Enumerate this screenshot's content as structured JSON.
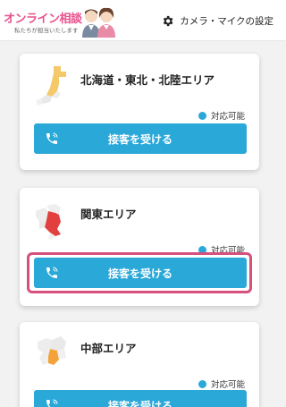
{
  "header": {
    "logo_title": "オンライン相談",
    "logo_subtitle": "私たちが担当いたします",
    "settings_label": "カメラ・マイクの設定"
  },
  "colors": {
    "brand_pink": "#e8508c",
    "accent_blue": "#2aa8d8",
    "highlight": "#d6507e",
    "map_yellow": "#f5c96a",
    "map_red": "#e2403e",
    "map_orange": "#f4a23a"
  },
  "icons": {
    "settings": "gear-icon",
    "call": "phone-icon",
    "status": "status-dot-icon"
  },
  "areas": [
    {
      "name": "北海道・東北・北陸エリア",
      "status": "対応可能",
      "button": "接客を受ける"
    },
    {
      "name": "関東エリア",
      "status": "対応可能",
      "button": "接客を受ける"
    },
    {
      "name": "中部エリア",
      "status": "対応可能",
      "button": "接客を受ける"
    }
  ]
}
